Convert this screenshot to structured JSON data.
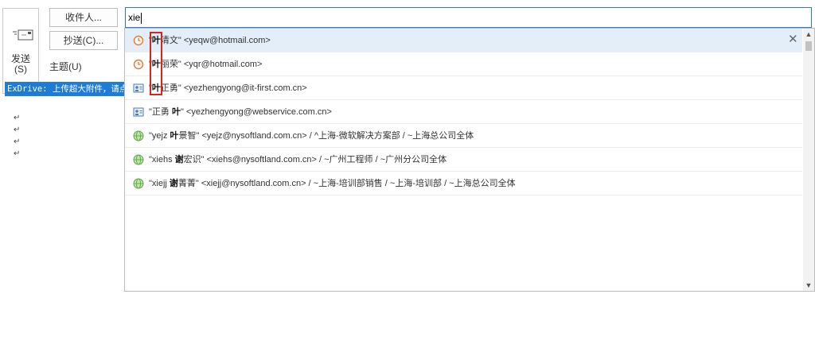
{
  "send_button": {
    "line1": "发送",
    "line2": "(S)"
  },
  "header": {
    "to_button": "收件人...",
    "cc_button": "抄送(C)...",
    "subject_label": "主题(U)",
    "to_value": "xie"
  },
  "exdrive_text": "ExDrive: 上传超大附件，请点击",
  "para_mark": "↵",
  "suggestions": [
    {
      "icon": "clock-icon",
      "pre": "\"",
      "bold": "叶",
      "post": "清文\" <yeqw@hotmail.com>"
    },
    {
      "icon": "clock-icon",
      "pre": "\"",
      "bold": "叶",
      "post": "丽荣\" <yqr@hotmail.com>"
    },
    {
      "icon": "contact-card-icon",
      "pre": "\"",
      "bold": "叶",
      "post": "正勇\" <yezhengyong@it-first.com.cn>"
    },
    {
      "icon": "contact-card-icon",
      "pre": "\"正勇 ",
      "bold": "叶",
      "post": "\" <yezhengyong@webservice.com.cn>"
    },
    {
      "icon": "globe-icon",
      "pre": "\"yejz ",
      "bold": "叶",
      "post": "景智\" <yejz@nysoftland.com.cn>  / ^上海-微软解决方案部 / ~上海总公司全体"
    },
    {
      "icon": "globe-icon",
      "pre": "\"xiehs ",
      "bold": "谢",
      "post": "宏识\" <xiehs@nysoftland.com.cn>  / ~广州工程师 / ~广州分公司全体"
    },
    {
      "icon": "globe-icon",
      "pre": "\"xiejj ",
      "bold": "谢",
      "post": "菁菁\" <xiejj@nysoftland.com.cn>  / ~上海-培训部销售 / ~上海-培训部 / ~上海总公司全体"
    }
  ],
  "colors": {
    "accent": "#2b79d7",
    "highlight_row": "#e3eef9",
    "annotation": "#d8231f",
    "exdrive": "#1e7bd6"
  }
}
